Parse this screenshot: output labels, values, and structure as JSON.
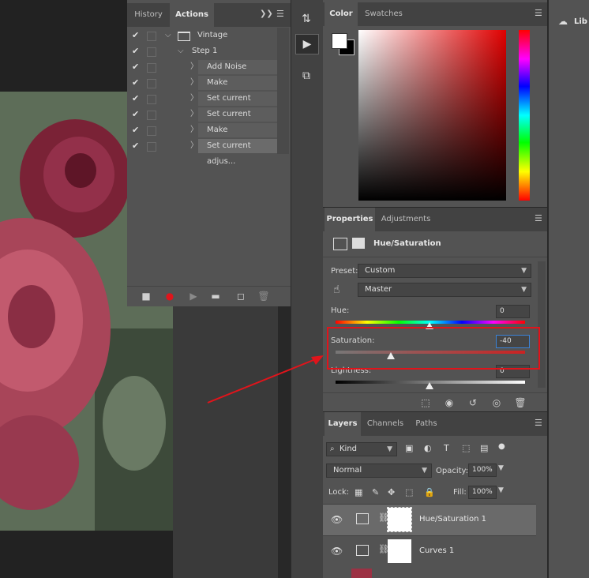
{
  "actions_panel": {
    "tabs": [
      "History",
      "Actions"
    ],
    "rows": [
      {
        "label": "Vintage",
        "level": 0,
        "expand": "⌵",
        "folder": true
      },
      {
        "label": "Step 1",
        "level": 1,
        "expand": "⌵"
      },
      {
        "label": "Add Noise",
        "level": 2,
        "expand": "〉"
      },
      {
        "label": "Make adjustment...",
        "level": 2,
        "expand": "〉"
      },
      {
        "label": "Set current adjus...",
        "level": 2,
        "expand": "〉"
      },
      {
        "label": "Set current adjus...",
        "level": 2,
        "expand": "〉"
      },
      {
        "label": "Make adjustment...",
        "level": 2,
        "expand": "〉"
      },
      {
        "label": "Set current adjus...",
        "level": 2,
        "expand": "〉",
        "selected": true
      }
    ],
    "footer_icons": [
      "stop-icon",
      "record-icon",
      "play-icon",
      "folder-icon",
      "new-action-icon",
      "trash-icon"
    ]
  },
  "color_panel": {
    "tabs": [
      "Color",
      "Swatches"
    ]
  },
  "properties_panel": {
    "tabs": [
      "Properties",
      "Adjustments"
    ],
    "title": "Hue/Saturation",
    "preset_label": "Preset:",
    "preset_value": "Custom",
    "channel_value": "Master",
    "hue_label": "Hue:",
    "hue_value": "0",
    "saturation_label": "Saturation:",
    "saturation_value": "-40",
    "lightness_label": "Lightness:",
    "lightness_value": "0"
  },
  "layers_panel": {
    "tabs": [
      "Layers",
      "Channels",
      "Paths"
    ],
    "filter_value": "Kind",
    "blend_mode": "Normal",
    "opacity_label": "Opacity:",
    "opacity_value": "100%",
    "lock_label": "Lock:",
    "fill_label": "Fill:",
    "fill_value": "100%",
    "layers": [
      {
        "name": "Hue/Saturation 1",
        "selected": true
      },
      {
        "name": "Curves 1",
        "selected": false
      }
    ]
  },
  "libraries": {
    "label": "Lib"
  },
  "colors": {
    "highlight": "#e0141b",
    "record": "#e0141b"
  }
}
